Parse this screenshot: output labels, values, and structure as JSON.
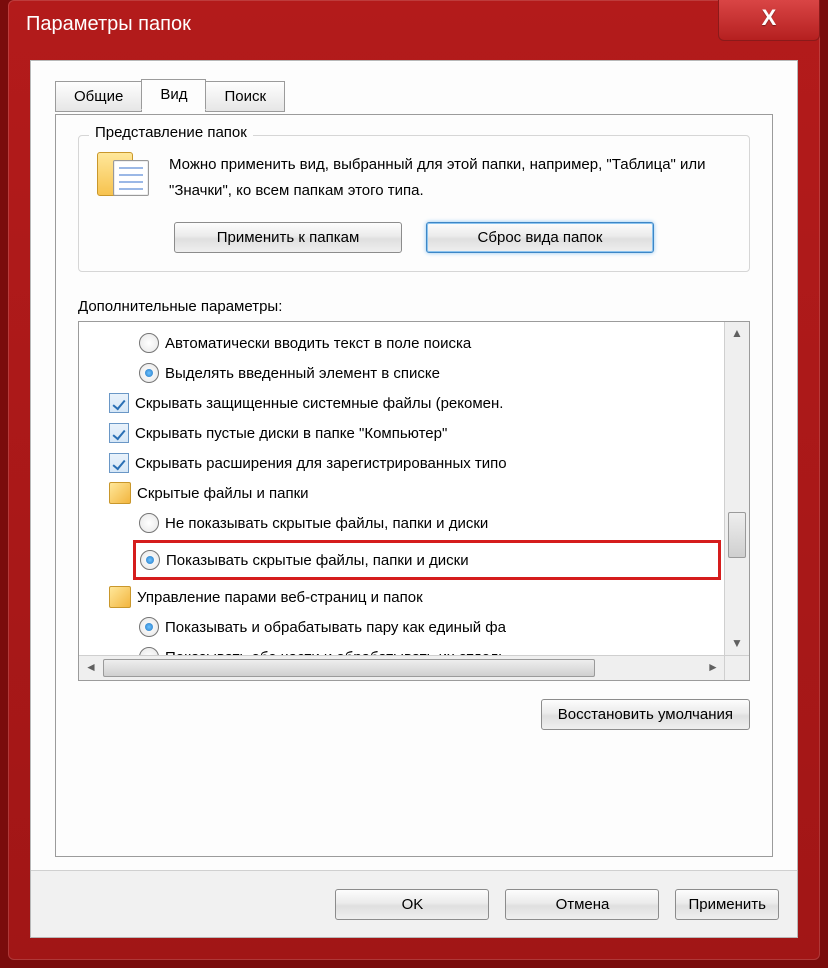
{
  "title": "Параметры папок",
  "tabs": {
    "general": "Общие",
    "view": "Вид",
    "search": "Поиск"
  },
  "group": {
    "legend": "Представление папок",
    "text": "Можно применить вид, выбранный для этой папки, например, \"Таблица\" или \"Значки\", ко всем папкам этого типа.",
    "apply": "Применить к папкам",
    "reset": "Сброс вида папок"
  },
  "advanced": {
    "label": "Дополнительные параметры:",
    "items": [
      {
        "kind": "radio",
        "checked": false,
        "indent": 1,
        "text": "Автоматически вводить текст в поле поиска"
      },
      {
        "kind": "radio",
        "checked": true,
        "indent": 1,
        "text": "Выделять введенный элемент в списке"
      },
      {
        "kind": "check",
        "indent": 0,
        "text": "Скрывать защищенные системные файлы (рекомен."
      },
      {
        "kind": "check",
        "indent": 0,
        "text": "Скрывать пустые диски в папке \"Компьютер\""
      },
      {
        "kind": "check",
        "indent": 0,
        "text": "Скрывать расширения для зарегистрированных типо"
      },
      {
        "kind": "folder",
        "indent": 0,
        "text": "Скрытые файлы и папки"
      },
      {
        "kind": "radio",
        "checked": false,
        "indent": 1,
        "text": "Не показывать скрытые файлы, папки и диски"
      },
      {
        "kind": "radio",
        "checked": true,
        "indent": 1,
        "highlight": true,
        "text": "Показывать скрытые файлы, папки и диски"
      },
      {
        "kind": "folder",
        "indent": 0,
        "text": "Управление парами веб-страниц и папок"
      },
      {
        "kind": "radio",
        "checked": true,
        "indent": 1,
        "text": "Показывать и обрабатывать пару как единый фа"
      },
      {
        "kind": "radio",
        "checked": false,
        "indent": 1,
        "text": "Показывать обе части и обрабатывать их отдель"
      }
    ],
    "restore": "Восстановить умолчания"
  },
  "footer": {
    "ok": "OK",
    "cancel": "Отмена",
    "apply": "Применить"
  }
}
